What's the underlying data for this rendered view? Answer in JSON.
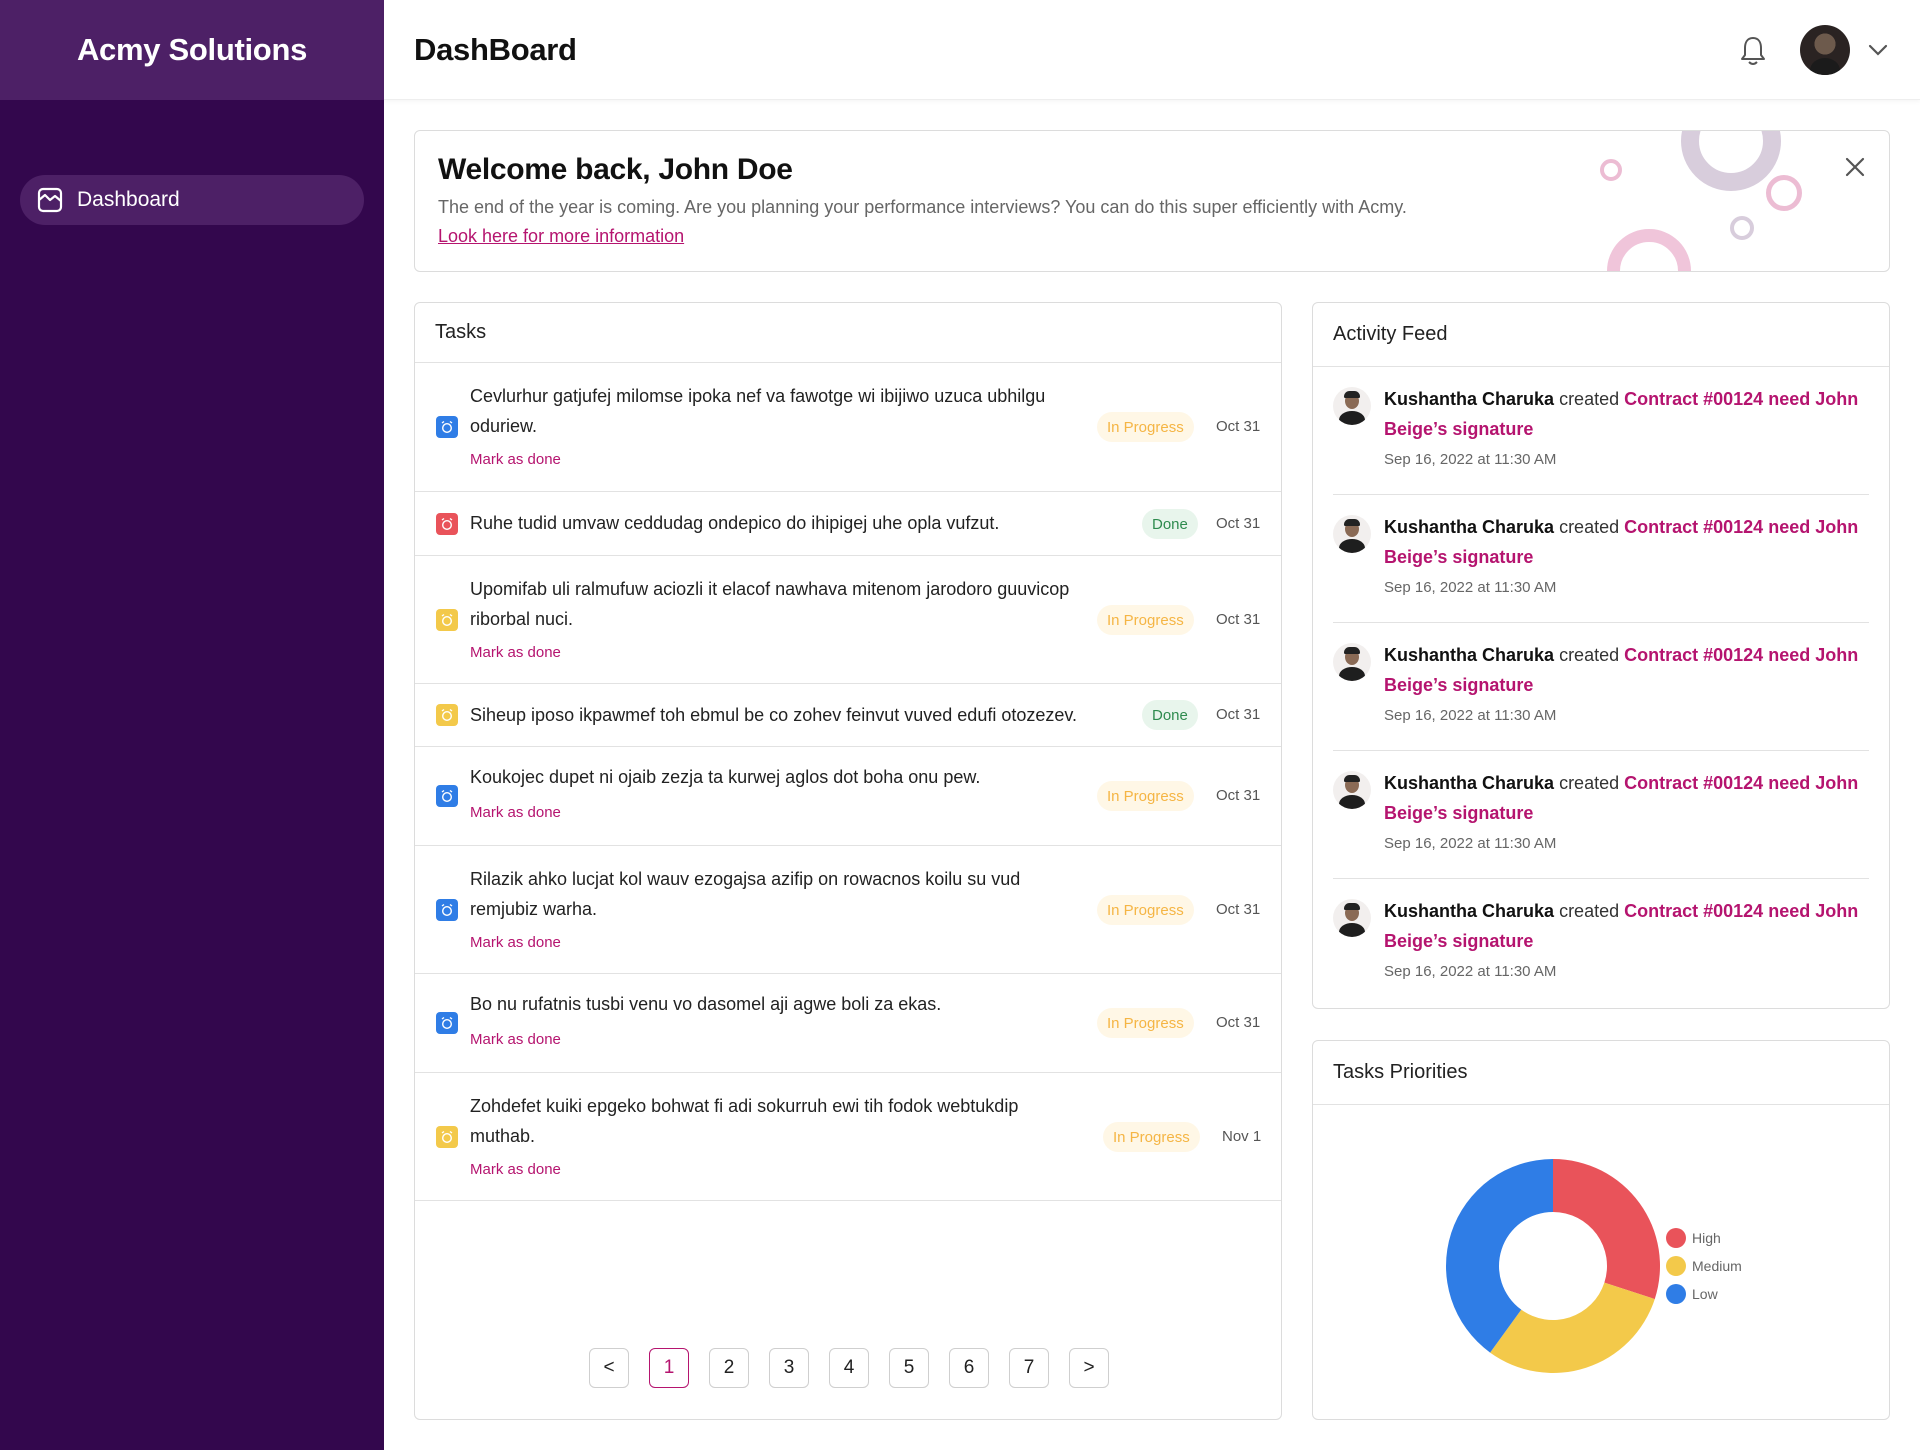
{
  "sidebar": {
    "brand": "Acmy Solutions",
    "items": [
      {
        "label": "Dashboard",
        "icon": "dashboard-icon"
      }
    ]
  },
  "header": {
    "title": "DashBoard",
    "icons": [
      "bell-icon",
      "avatar",
      "chevron-down-icon"
    ]
  },
  "welcome": {
    "title": "Welcome back, John Doe",
    "subtitle": "The end of the year is coming. Are you planning your performance interviews? You can do this super efficiently with Acmy.",
    "link": "Look here for more information"
  },
  "tasks": {
    "title": "Tasks",
    "mark_label": "Mark as done",
    "items": [
      {
        "text": "Cevlurhur gatjufej milomse ipoka nef va fawotge wi ibijiwo uzuca ubhilgu oduriew.",
        "status": "In Progress",
        "date": "Oct 31",
        "priority": "Low"
      },
      {
        "text": "Ruhe tudid umvaw ceddudag ondepico do ihipigej uhe opla vufzut.",
        "status": "Done",
        "date": "Oct 31",
        "priority": "High"
      },
      {
        "text": "Upomifab uli ralmufuw aciozli it elacof nawhava mitenom jarodoro guuvicop riborbal nuci.",
        "status": "In Progress",
        "date": "Oct 31",
        "priority": "Medium"
      },
      {
        "text": "Siheup iposo ikpawmef toh ebmul be co zohev feinvut vuved edufi otozezev.",
        "status": "Done",
        "date": "Oct 31",
        "priority": "Medium"
      },
      {
        "text": "Koukojec dupet ni ojaib zezja ta kurwej aglos dot boha onu pew.",
        "status": "In Progress",
        "date": "Oct 31",
        "priority": "Low"
      },
      {
        "text": "Rilazik ahko lucjat kol wauv ezogajsa azifip on rowacnos koilu su vud remjubiz warha.",
        "status": "In Progress",
        "date": "Oct 31",
        "priority": "Low"
      },
      {
        "text": "Bo nu rufatnis tusbi venu vo dasomel aji agwe boli za ekas.",
        "status": "In Progress",
        "date": "Oct 31",
        "priority": "Low"
      },
      {
        "text": "Zohdefet kuiki epgeko bohwat fi adi sokurruh ewi tih fodok webtukdip muthab.",
        "status": "In Progress",
        "date": "Nov 1",
        "priority": "Medium"
      }
    ],
    "pagination": {
      "prev": "<",
      "next": ">",
      "pages": [
        "1",
        "2",
        "3",
        "4",
        "5",
        "6",
        "7"
      ],
      "current": "1"
    }
  },
  "feed": {
    "title": "Activity Feed",
    "items": [
      {
        "user": "Kushantha Charuka",
        "action": "created",
        "link": "Contract #00124 need John Beige’s signature",
        "time": "Sep 16, 2022 at 11:30 AM"
      },
      {
        "user": "Kushantha Charuka",
        "action": "created",
        "link": "Contract #00124 need John Beige’s signature",
        "time": "Sep 16, 2022 at 11:30 AM"
      },
      {
        "user": "Kushantha Charuka",
        "action": "created",
        "link": "Contract #00124 need John Beige’s signature",
        "time": "Sep 16, 2022 at 11:30 AM"
      },
      {
        "user": "Kushantha Charuka",
        "action": "created",
        "link": "Contract #00124 need John Beige’s signature",
        "time": "Sep 16, 2022 at 11:30 AM"
      },
      {
        "user": "Kushantha Charuka",
        "action": "created",
        "link": "Contract #00124 need John Beige’s signature",
        "time": "Sep 16, 2022 at 11:30 AM"
      }
    ]
  },
  "priorities": {
    "title": "Tasks Priorities"
  },
  "colors": {
    "sidebar": "#33074d",
    "brand_bg": "#4d2066",
    "accent": "#b5146f",
    "high": "#e9535a",
    "medium": "#f3c94a",
    "low": "#2f7de6"
  },
  "chart_data": {
    "type": "pie",
    "variant": "donut",
    "categories": [
      "High",
      "Medium",
      "Low"
    ],
    "values": [
      3,
      3,
      4
    ],
    "colors": [
      "#e9535a",
      "#f3c94a",
      "#2f7de6"
    ],
    "legend": "right"
  }
}
